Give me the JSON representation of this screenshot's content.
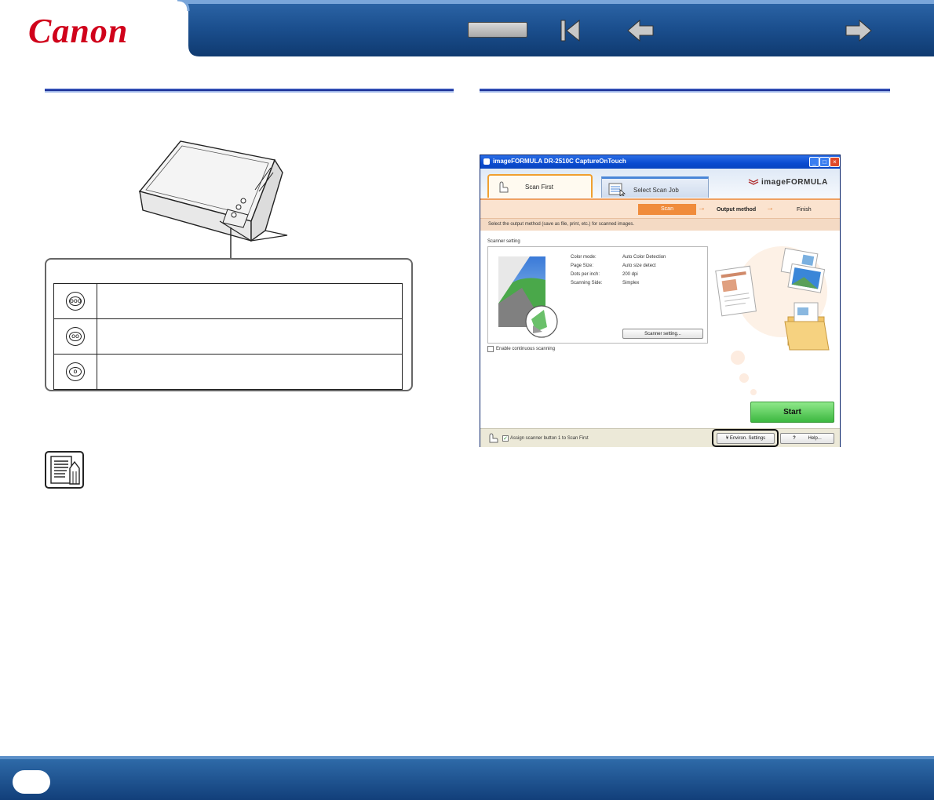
{
  "header": {
    "logo": "Canon",
    "nav_buttons": [
      "top-button",
      "first-page",
      "previous-page",
      "next-page"
    ]
  },
  "panel": {
    "rows": [
      {
        "icon": "ooo",
        "text": ""
      },
      {
        "icon": "oo",
        "text": ""
      },
      {
        "icon": "o",
        "text": ""
      }
    ]
  },
  "app_window": {
    "title": "imageFORMULA DR-2510C CaptureOnTouch",
    "tabs": {
      "scan_first": "Scan First",
      "select_scan_job": "Select Scan Job"
    },
    "brand": "imageFORMULA",
    "steps": {
      "scan": "Scan",
      "output": "Output method",
      "finish": "Finish"
    },
    "instruction": "Select the output method (save as file, print, etc.) for scanned images.",
    "scanner_setting_label": "Scanner setting",
    "settings": [
      {
        "key": "Color mode:",
        "value": "Auto Color Detection"
      },
      {
        "key": "Page Size:",
        "value": "Auto size detect"
      },
      {
        "key": "Dots per inch:",
        "value": "200 dpi"
      },
      {
        "key": "Scanning Side:",
        "value": "Simplex"
      }
    ],
    "scanner_setting_button": "Scanner setting...",
    "continuous_label": "Enable continuous scanning",
    "start_button": "Start",
    "assign_label": "Assign scanner button 1 to Scan First",
    "environ_button": "Environ. Settings",
    "help_button": "Help..."
  },
  "colors": {
    "header_bg": "#1b4f8e",
    "canon_red": "#d0021b",
    "rule_blue": "#1a2c8c",
    "start_green": "#3cb840",
    "step_orange": "#f08c3c"
  }
}
